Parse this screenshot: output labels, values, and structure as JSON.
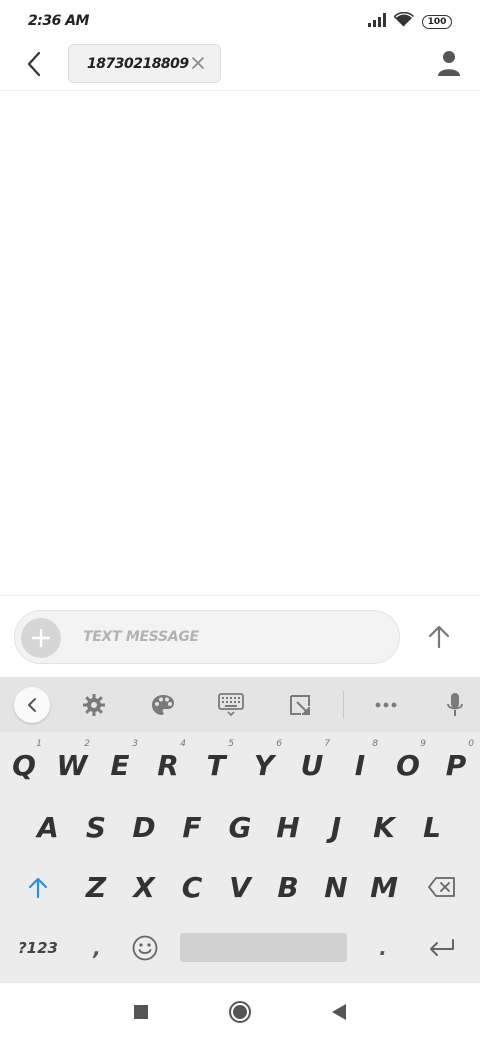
{
  "status_bar": {
    "time": "2:36 AM",
    "battery": "100",
    "icons": [
      "signal-icon",
      "wifi-icon",
      "battery-icon"
    ]
  },
  "header": {
    "recipient": "18730218809",
    "icons": [
      "back-icon",
      "close-icon",
      "contact-icon"
    ]
  },
  "compose": {
    "placeholder": "TEXT MESSAGE",
    "icons": [
      "plus-icon",
      "send-arrow-icon"
    ]
  },
  "keyboard": {
    "toolbar": [
      "chevron-left-icon",
      "gear-icon",
      "palette-icon",
      "keyboard-icon",
      "resize-icon",
      "more-icon",
      "microphone-icon"
    ],
    "row1": [
      {
        "key": "Q",
        "hint": "1"
      },
      {
        "key": "W",
        "hint": "2"
      },
      {
        "key": "E",
        "hint": "3"
      },
      {
        "key": "R",
        "hint": "4"
      },
      {
        "key": "T",
        "hint": "5"
      },
      {
        "key": "Y",
        "hint": "6"
      },
      {
        "key": "U",
        "hint": "7"
      },
      {
        "key": "I",
        "hint": "8"
      },
      {
        "key": "O",
        "hint": "9"
      },
      {
        "key": "P",
        "hint": "0"
      }
    ],
    "row2": [
      "A",
      "S",
      "D",
      "F",
      "G",
      "H",
      "J",
      "K",
      "L"
    ],
    "row3": [
      "Z",
      "X",
      "C",
      "V",
      "B",
      "N",
      "M"
    ],
    "row4": {
      "symbols": "?123",
      "comma": ",",
      "period": "."
    },
    "colors": {
      "shift": "#2f8fdc",
      "background": "#ececec",
      "toolbar": "#e4e4e4"
    }
  },
  "nav_bar": {
    "icons": [
      "recents-square-icon",
      "home-circle-icon",
      "back-triangle-icon"
    ]
  }
}
